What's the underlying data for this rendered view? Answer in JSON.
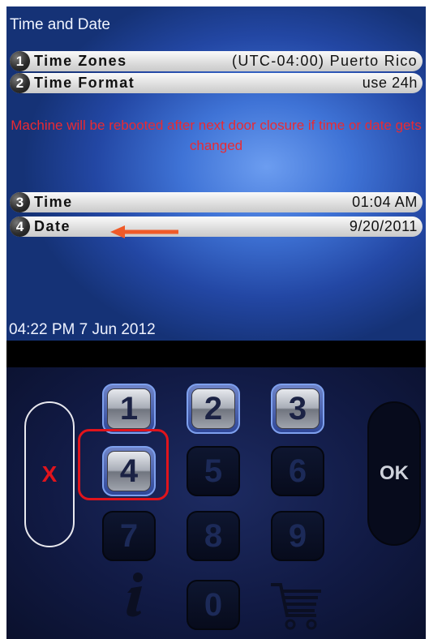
{
  "screen": {
    "title": "Time and Date",
    "rows": [
      {
        "number": "1",
        "label": "Time Zones",
        "value": "(UTC-04:00) Puerto Rico"
      },
      {
        "number": "2",
        "label": "Time Format",
        "value": "use 24h"
      },
      {
        "number": "3",
        "label": "Time",
        "value": "01:04 AM"
      },
      {
        "number": "4",
        "label": "Date",
        "value": "9/20/2011"
      }
    ],
    "warning": "Machine will be rebooted after next door closure if time or date gets changed",
    "clock": "04:22 PM 7 Jun 2012"
  },
  "keypad": {
    "keys": [
      "1",
      "2",
      "3",
      "4",
      "5",
      "6",
      "7",
      "8",
      "9",
      "0"
    ],
    "cancel_label": "X",
    "ok_label": "OK",
    "info_icon": "info-icon",
    "cart_icon": "cart-icon"
  },
  "colors": {
    "screen_blue": "#3f73d6",
    "warning_red": "#ea2a32",
    "highlight_red": "#e0141c",
    "arrow_orange": "#f05a28"
  }
}
